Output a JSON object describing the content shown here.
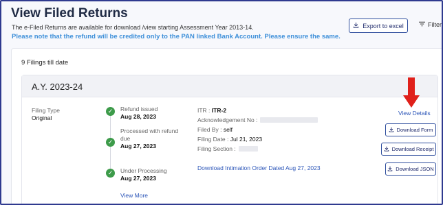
{
  "header": {
    "title": "View Filed Returns",
    "subtitle": "The e-Filed Returns are available for download /view starting Assessment Year 2013-14.",
    "notice": "Please note that the refund will be credited only to the PAN linked Bank Account. Please ensure the same.",
    "export_label": "Export to excel",
    "filter_label": "Filter"
  },
  "filings": {
    "count_text": "9 Filings till date",
    "items": [
      {
        "assessment_year": "A.Y. 2023-24",
        "filing_type_label": "Filing Type",
        "filing_type_value": "Original",
        "timeline": [
          {
            "status": "Refund issued",
            "date": "Aug 28, 2023"
          },
          {
            "status_line1": "Processed with refund",
            "status_line2": "due",
            "date": "Aug 27, 2023"
          },
          {
            "status": "Under Processing",
            "date": "Aug 27, 2023"
          }
        ],
        "view_more_label": "View More",
        "itr_label": "ITR :",
        "itr_value": "ITR-2",
        "ack_label": "Acknowledgement No :",
        "filed_by_label": "Filed By :",
        "filed_by_value": "self",
        "filing_date_label": "Filing Date :",
        "filing_date_value": "Jul 21, 2023",
        "filing_section_label": "Filing Section :",
        "download_intimation_label": "Download Intimation Order Dated Aug 27, 2023",
        "view_details_label": "View Details",
        "download_form_label": "Download Form",
        "download_receipt_label": "Download Receipt",
        "download_json_label": "Download JSON"
      }
    ]
  },
  "colors": {
    "primary_blue": "#2b55b8",
    "notice_blue": "#3d8fd9",
    "success_green": "#3d9b4a",
    "arrow_red": "#e0201a"
  },
  "icons": {
    "export": "download-icon",
    "filter": "filter-icon",
    "step": "check-circle-icon",
    "annotation": "red-arrow-down-icon"
  }
}
